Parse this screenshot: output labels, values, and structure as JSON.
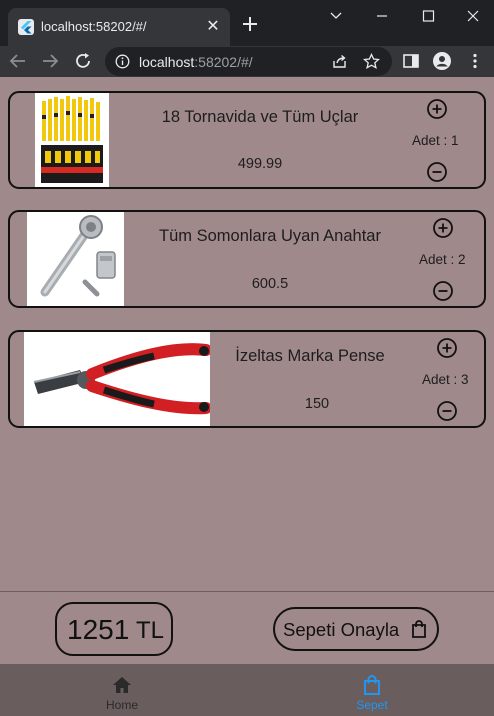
{
  "browser": {
    "tab_title": "localhost:58202/#/",
    "url_host": "localhost",
    "url_rest": ":58202/#/"
  },
  "products": [
    {
      "name": "18 Tornavida ve Tüm Uçlar",
      "price": "499.99",
      "qty_label": "Adet : 1"
    },
    {
      "name": "Tüm Somonlara Uyan Anahtar",
      "price": "600.5",
      "qty_label": "Adet : 2"
    },
    {
      "name": "İzeltas Marka Pense",
      "price": "150",
      "qty_label": "Adet : 3"
    }
  ],
  "footer": {
    "total_value": "1251",
    "total_currency": "TL",
    "confirm_label": "Sepeti Onayla"
  },
  "bottom_nav": {
    "home_label": "Home",
    "cart_label": "Sepet",
    "active_color": "#2196f3",
    "inactive_color": "#2a2a2a"
  },
  "colors": {
    "page_bg": "#a0898b",
    "chrome_dark": "#202124",
    "chrome_toolbar": "#35363a"
  }
}
